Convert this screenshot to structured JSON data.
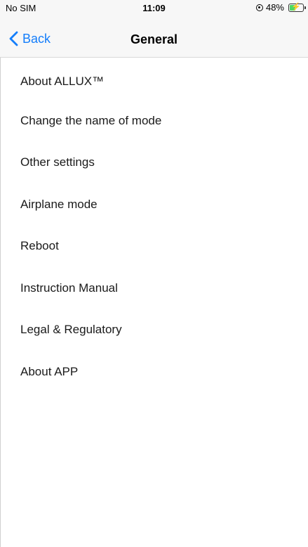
{
  "status_bar": {
    "carrier": "No SIM",
    "time": "11:09",
    "battery_percent": "48%",
    "battery_level": 0.48,
    "icons": [
      "orientation-lock-icon",
      "battery-charging-icon"
    ],
    "battery_color": "#4cd964"
  },
  "nav": {
    "back_label": "Back",
    "title": "General",
    "accent_color": "#147efb"
  },
  "menu": {
    "items": [
      {
        "label": "About ALLUX™"
      },
      {
        "label": "Change the name of mode"
      },
      {
        "label": "Other settings"
      },
      {
        "label": "Airplane mode"
      },
      {
        "label": "Reboot"
      },
      {
        "label": "Instruction Manual"
      },
      {
        "label": "Legal & Regulatory"
      },
      {
        "label": "About APP"
      }
    ]
  }
}
